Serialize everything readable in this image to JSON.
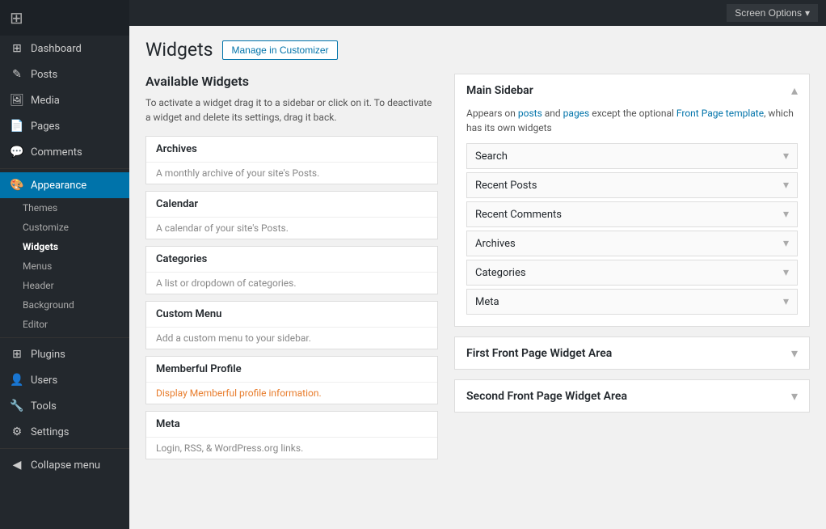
{
  "topbar": {
    "screen_options_label": "Screen Options",
    "chevron": "▾"
  },
  "sidebar": {
    "logo_icon": "⊞",
    "items": [
      {
        "id": "dashboard",
        "label": "Dashboard",
        "icon": "⊞"
      },
      {
        "id": "posts",
        "label": "Posts",
        "icon": "✎"
      },
      {
        "id": "media",
        "label": "Media",
        "icon": "⊞"
      },
      {
        "id": "pages",
        "label": "Pages",
        "icon": "⊞"
      },
      {
        "id": "comments",
        "label": "Comments",
        "icon": "💬"
      },
      {
        "id": "appearance",
        "label": "Appearance",
        "icon": "🎨",
        "active": true
      },
      {
        "id": "plugins",
        "label": "Plugins",
        "icon": "⊞"
      },
      {
        "id": "users",
        "label": "Users",
        "icon": "👤"
      },
      {
        "id": "tools",
        "label": "Tools",
        "icon": "🔧"
      },
      {
        "id": "settings",
        "label": "Settings",
        "icon": "⚙"
      },
      {
        "id": "collapse",
        "label": "Collapse menu",
        "icon": "◀"
      }
    ],
    "appearance_sub": [
      {
        "id": "themes",
        "label": "Themes"
      },
      {
        "id": "customize",
        "label": "Customize"
      },
      {
        "id": "widgets",
        "label": "Widgets",
        "active": true
      },
      {
        "id": "menus",
        "label": "Menus"
      },
      {
        "id": "header",
        "label": "Header"
      },
      {
        "id": "background",
        "label": "Background"
      },
      {
        "id": "editor",
        "label": "Editor"
      }
    ]
  },
  "page": {
    "title": "Widgets",
    "manage_btn_label": "Manage in Customizer"
  },
  "available_widgets": {
    "heading": "Available Widgets",
    "description": "To activate a widget drag it to a sidebar or click on it. To deactivate a widget and delete its settings, drag it back.",
    "widgets": [
      {
        "id": "archives",
        "title": "Archives",
        "desc": "A monthly archive of your site's Posts.",
        "desc_class": ""
      },
      {
        "id": "calendar",
        "title": "Calendar",
        "desc": "A calendar of your site's Posts.",
        "desc_class": ""
      },
      {
        "id": "categories",
        "title": "Categories",
        "desc": "A list or dropdown of categories.",
        "desc_class": ""
      },
      {
        "id": "custom-menu",
        "title": "Custom Menu",
        "desc": "Add a custom menu to your sidebar.",
        "desc_class": ""
      },
      {
        "id": "memberful-profile",
        "title": "Memberful Profile",
        "desc": "Display Memberful profile information.",
        "desc_class": "memberful"
      },
      {
        "id": "meta",
        "title": "Meta",
        "desc": "Login, RSS, & WordPress.org links.",
        "desc_class": ""
      }
    ]
  },
  "main_sidebar": {
    "title": "Main Sidebar",
    "desc_parts": [
      "Appears on ",
      "posts",
      " and ",
      "pages",
      " except the optional ",
      "Front Page template",
      ", which has its own widgets"
    ],
    "desc_links": {
      "posts": true,
      "pages": true,
      "front_page": true
    },
    "widgets": [
      {
        "id": "search",
        "label": "Search"
      },
      {
        "id": "recent-posts",
        "label": "Recent Posts"
      },
      {
        "id": "recent-comments",
        "label": "Recent Comments"
      },
      {
        "id": "archives",
        "label": "Archives"
      },
      {
        "id": "categories",
        "label": "Categories"
      },
      {
        "id": "meta",
        "label": "Meta"
      }
    ]
  },
  "other_areas": [
    {
      "id": "first-front-page",
      "title": "First Front Page Widget Area"
    },
    {
      "id": "second-front-page",
      "title": "Second Front Page Widget Area"
    }
  ]
}
